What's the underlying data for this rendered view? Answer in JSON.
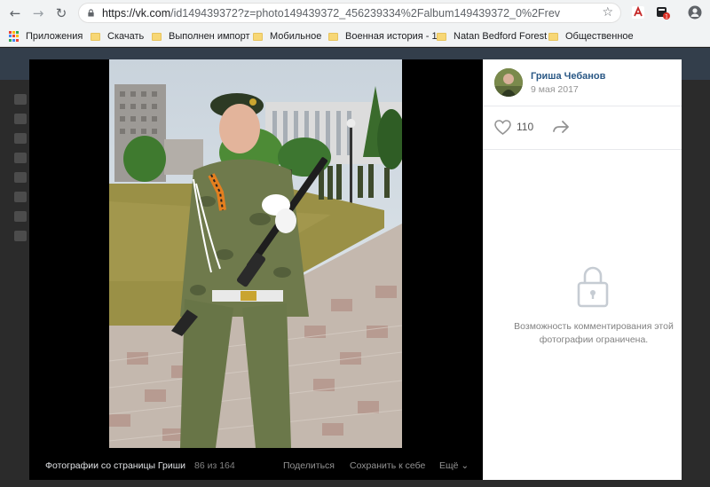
{
  "browser": {
    "url_host": "https://vk.com",
    "url_path": "/id149439372?z=photo149439372_456239334%2Falbum149439372_0%2Frev",
    "bookmarks": [
      {
        "label": "Приложения",
        "type": "apps"
      },
      {
        "label": "Скачать",
        "type": "folder"
      },
      {
        "label": "Выполнен импорт",
        "type": "folder"
      },
      {
        "label": "Мобильное",
        "type": "folder"
      },
      {
        "label": "Военная история - 1",
        "type": "folder"
      },
      {
        "label": "Natan Bedford Forest",
        "type": "folder"
      },
      {
        "label": "Общественное",
        "type": "folder"
      }
    ],
    "icons": [
      "back-icon",
      "forward-icon",
      "reload-icon",
      "lock-icon",
      "star-icon",
      "pdf-extension-icon",
      "extension-icon",
      "profile-icon"
    ]
  },
  "viewer": {
    "caption": "Фотографии со страницы Гриши",
    "counter": "86 из 164",
    "actions": {
      "share": "Поделиться",
      "save": "Сохранить к себе",
      "more": "Ещё ⌄"
    }
  },
  "panel": {
    "author": "Гриша Чебанов",
    "date": "9 мая 2017",
    "likes": "110",
    "restricted_text": "Возможность комментирования этой фотографии ограничена."
  },
  "colors": {
    "link": "#2a5885",
    "muted": "#939393",
    "chrome_bg": "#f1f3f4",
    "viewer_bg": "#000000"
  }
}
